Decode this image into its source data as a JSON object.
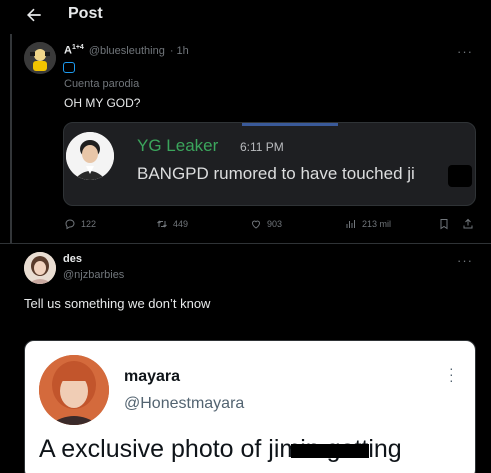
{
  "header": {
    "title": "Post",
    "back_icon": "arrow-left-icon"
  },
  "tweet": {
    "author_name": "A",
    "author_sup": "1+4",
    "author_handle": "@bluesleuthing",
    "time": "· 1h",
    "label": "Cuenta parodia",
    "text": "OH MY GOD?",
    "media": {
      "leaker_name": "YG Leaker",
      "leaker_time": "6:11 PM",
      "leaker_text": "BANGPD rumored to have touched ji"
    },
    "stats": {
      "replies": "122",
      "retweets": "449",
      "likes": "903",
      "views": "213 mil"
    }
  },
  "reply": {
    "author_name": "des",
    "author_handle": "@njzbarbies",
    "text": "Tell us something we don’t know",
    "media": {
      "name": "mayara",
      "handle": "@Honestmayara",
      "text": "A exclusive photo of jimin getting"
    }
  },
  "colors": {
    "background": "#000000",
    "accent": "#1d9bf0",
    "discord_green": "#3ba55c"
  }
}
